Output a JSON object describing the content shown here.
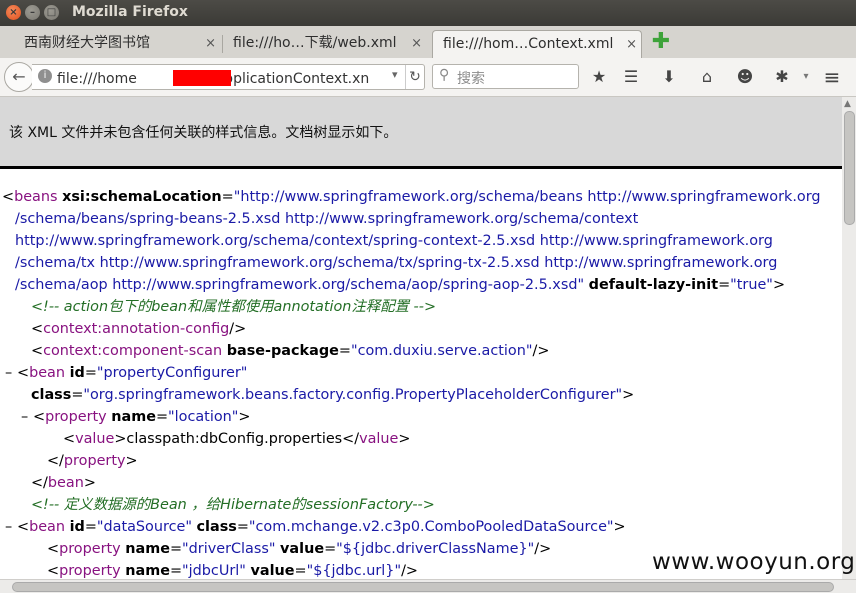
{
  "window": {
    "title": "Mozilla Firefox",
    "close": "×",
    "minimize": "–",
    "maximize": "□"
  },
  "tabs": [
    {
      "label": "西南财经大学图书馆",
      "close": "×"
    },
    {
      "label": "file:///ho…下载/web.xml",
      "close": "×"
    },
    {
      "label": "file:///hom…Context.xml",
      "close": "×"
    }
  ],
  "newtab": "✚",
  "nav": {
    "back": "←",
    "url_prefix": "file:///home",
    "url_suffix": "下载/applicationContext.xn",
    "dropdown": "▾",
    "reload": "↻",
    "search_placeholder": "搜索",
    "search_icon": "🔍"
  },
  "toolbar_icons": [
    "★",
    "☰",
    "⬇",
    "⌂",
    "☻",
    "✱",
    "≡"
  ],
  "banner": "该 XML 文件并未包含任何关联的样式信息。文档树显示如下。",
  "xml_lines": [
    {
      "indent": 2,
      "collapse": "–",
      "parts": [
        [
          "p",
          "<"
        ],
        [
          "t",
          "beans"
        ],
        [
          "p",
          " "
        ],
        [
          "a",
          "xsi:schemaLocation"
        ],
        [
          "p",
          "="
        ],
        [
          "v",
          "\"http://www.springframework.org/schema/beans http://www.springframework.org"
        ]
      ]
    },
    {
      "indent": 15,
      "parts": [
        [
          "v",
          "/schema/beans/spring-beans-2.5.xsd http://www.springframework.org/schema/context"
        ]
      ]
    },
    {
      "indent": 15,
      "parts": [
        [
          "v",
          "http://www.springframework.org/schema/context/spring-context-2.5.xsd http://www.springframework.org"
        ]
      ]
    },
    {
      "indent": 15,
      "parts": [
        [
          "v",
          "/schema/tx http://www.springframework.org/schema/tx/spring-tx-2.5.xsd http://www.springframework.org"
        ]
      ]
    },
    {
      "indent": 15,
      "parts": [
        [
          "v",
          "/schema/aop http://www.springframework.org/schema/aop/spring-aop-2.5.xsd\""
        ],
        [
          "p",
          " "
        ],
        [
          "a",
          "default-lazy-init"
        ],
        [
          "p",
          "="
        ],
        [
          "v",
          "\"true\""
        ],
        [
          "p",
          ">"
        ]
      ]
    },
    {
      "indent": 31,
      "parts": [
        [
          "c",
          "<!-- action包下的bean和属性都使用annotation注释配置 -->"
        ]
      ]
    },
    {
      "indent": 31,
      "parts": [
        [
          "p",
          "<"
        ],
        [
          "t",
          "context:annotation-config"
        ],
        [
          "p",
          "/>"
        ]
      ]
    },
    {
      "indent": 31,
      "parts": [
        [
          "p",
          "<"
        ],
        [
          "t",
          "context:component-scan"
        ],
        [
          "p",
          " "
        ],
        [
          "a",
          "base-package"
        ],
        [
          "p",
          "="
        ],
        [
          "v",
          "\"com.duxiu.serve.action\""
        ],
        [
          "p",
          "/>"
        ]
      ]
    },
    {
      "indent": 17,
      "collapse": "–",
      "parts": [
        [
          "p",
          "<"
        ],
        [
          "t",
          "bean"
        ],
        [
          "p",
          " "
        ],
        [
          "a",
          "id"
        ],
        [
          "p",
          "="
        ],
        [
          "v",
          "\"propertyConfigurer\""
        ]
      ]
    },
    {
      "indent": 31,
      "parts": [
        [
          "a",
          "class"
        ],
        [
          "p",
          "="
        ],
        [
          "v",
          "\"org.springframework.beans.factory.config.PropertyPlaceholderConfigurer\""
        ],
        [
          "p",
          ">"
        ]
      ]
    },
    {
      "indent": 33,
      "collapse": "–",
      "parts": [
        [
          "p",
          "<"
        ],
        [
          "t",
          "property"
        ],
        [
          "p",
          " "
        ],
        [
          "a",
          "name"
        ],
        [
          "p",
          "="
        ],
        [
          "v",
          "\"location\""
        ],
        [
          "p",
          ">"
        ]
      ]
    },
    {
      "indent": 63,
      "parts": [
        [
          "p",
          "<"
        ],
        [
          "t",
          "value"
        ],
        [
          "p",
          ">classpath:dbConfig.properties</"
        ],
        [
          "t",
          "value"
        ],
        [
          "p",
          ">"
        ]
      ]
    },
    {
      "indent": 47,
      "parts": [
        [
          "p",
          "</"
        ],
        [
          "t",
          "property"
        ],
        [
          "p",
          ">"
        ]
      ]
    },
    {
      "indent": 31,
      "parts": [
        [
          "p",
          "</"
        ],
        [
          "t",
          "bean"
        ],
        [
          "p",
          ">"
        ]
      ]
    },
    {
      "indent": 31,
      "parts": [
        [
          "c",
          "<!-- 定义数据源的Bean ，给Hibernate的sessionFactory-->"
        ]
      ]
    },
    {
      "indent": 17,
      "collapse": "–",
      "parts": [
        [
          "p",
          "<"
        ],
        [
          "t",
          "bean"
        ],
        [
          "p",
          " "
        ],
        [
          "a",
          "id"
        ],
        [
          "p",
          "="
        ],
        [
          "v",
          "\"dataSource\""
        ],
        [
          "p",
          " "
        ],
        [
          "a",
          "class"
        ],
        [
          "p",
          "="
        ],
        [
          "v",
          "\"com.mchange.v2.c3p0.ComboPooledDataSource\""
        ],
        [
          "p",
          ">"
        ]
      ]
    },
    {
      "indent": 47,
      "parts": [
        [
          "p",
          "<"
        ],
        [
          "t",
          "property"
        ],
        [
          "p",
          " "
        ],
        [
          "a",
          "name"
        ],
        [
          "p",
          "="
        ],
        [
          "v",
          "\"driverClass\""
        ],
        [
          "p",
          " "
        ],
        [
          "a",
          "value"
        ],
        [
          "p",
          "="
        ],
        [
          "v",
          "\"${jdbc.driverClassName}\""
        ],
        [
          "p",
          "/>"
        ]
      ]
    },
    {
      "indent": 47,
      "parts": [
        [
          "p",
          "<"
        ],
        [
          "t",
          "property"
        ],
        [
          "p",
          " "
        ],
        [
          "a",
          "name"
        ],
        [
          "p",
          "="
        ],
        [
          "v",
          "\"jdbcUrl\""
        ],
        [
          "p",
          " "
        ],
        [
          "a",
          "value"
        ],
        [
          "p",
          "="
        ],
        [
          "v",
          "\"${jdbc.url}\""
        ],
        [
          "p",
          "/>"
        ]
      ]
    }
  ],
  "watermark": "www.wooyun.org",
  "colors": {
    "tag": "#881280",
    "attr_value": "#1a1aa6",
    "comment": "#236e25",
    "redaction": "#ff0000"
  }
}
